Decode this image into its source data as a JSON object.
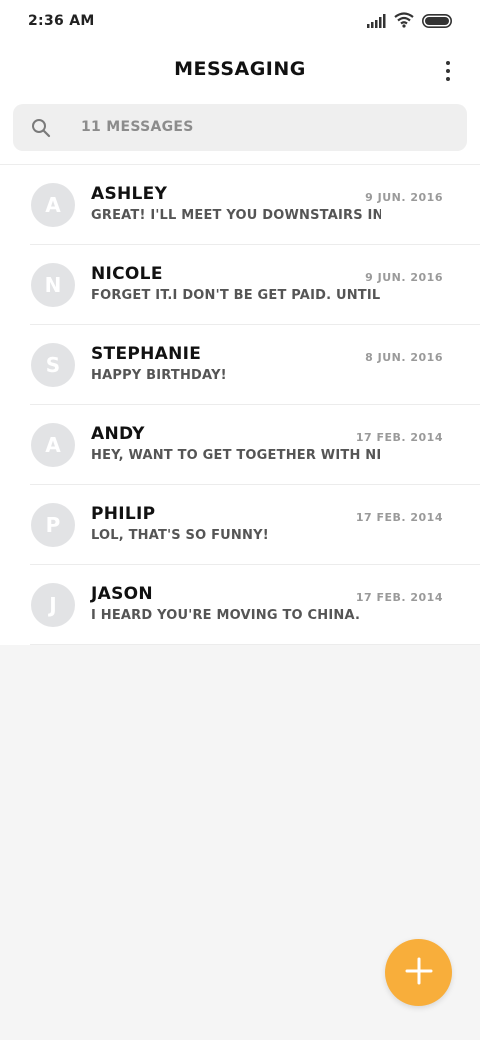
{
  "status_bar": {
    "time": "2:36 AM",
    "icons": [
      "signal-icon",
      "wifi-icon",
      "battery-icon"
    ]
  },
  "app_bar": {
    "title": "MESSAGING",
    "menu_icon": "more-vert-icon"
  },
  "search": {
    "icon": "search-icon",
    "placeholder": "11 MESSAGES"
  },
  "conversations": [
    {
      "initial": "A",
      "name": "ASHLEY",
      "date": "9 JUN. 2016",
      "preview": "GREAT! I'LL MEET YOU DOWNSTAIRS IN TE"
    },
    {
      "initial": "N",
      "name": "NICOLE",
      "date": "9 JUN. 2016",
      "preview": "FORGET IT.I DON'T BE GET PAID. UNTIL NE"
    },
    {
      "initial": "S",
      "name": "STEPHANIE",
      "date": "8 JUN. 2016",
      "preview": "HAPPY BIRTHDAY!"
    },
    {
      "initial": "A",
      "name": "ANDY",
      "date": "17 FEB. 2014",
      "preview": "HEY, WANT TO GET TOGETHER WITH NICOL"
    },
    {
      "initial": "P",
      "name": "PHILIP",
      "date": "17 FEB. 2014",
      "preview": "LOL, THAT'S SO FUNNY!"
    },
    {
      "initial": "J",
      "name": "JASON",
      "date": "17 FEB. 2014",
      "preview": "I HEARD YOU'RE MOVING TO CHINA."
    }
  ],
  "fab": {
    "icon": "plus-icon",
    "color": "#F8AE3B"
  },
  "colors": {
    "accent": "#F8AE3B",
    "background": "#F5F5F5",
    "avatar": "#E2E3E5"
  }
}
